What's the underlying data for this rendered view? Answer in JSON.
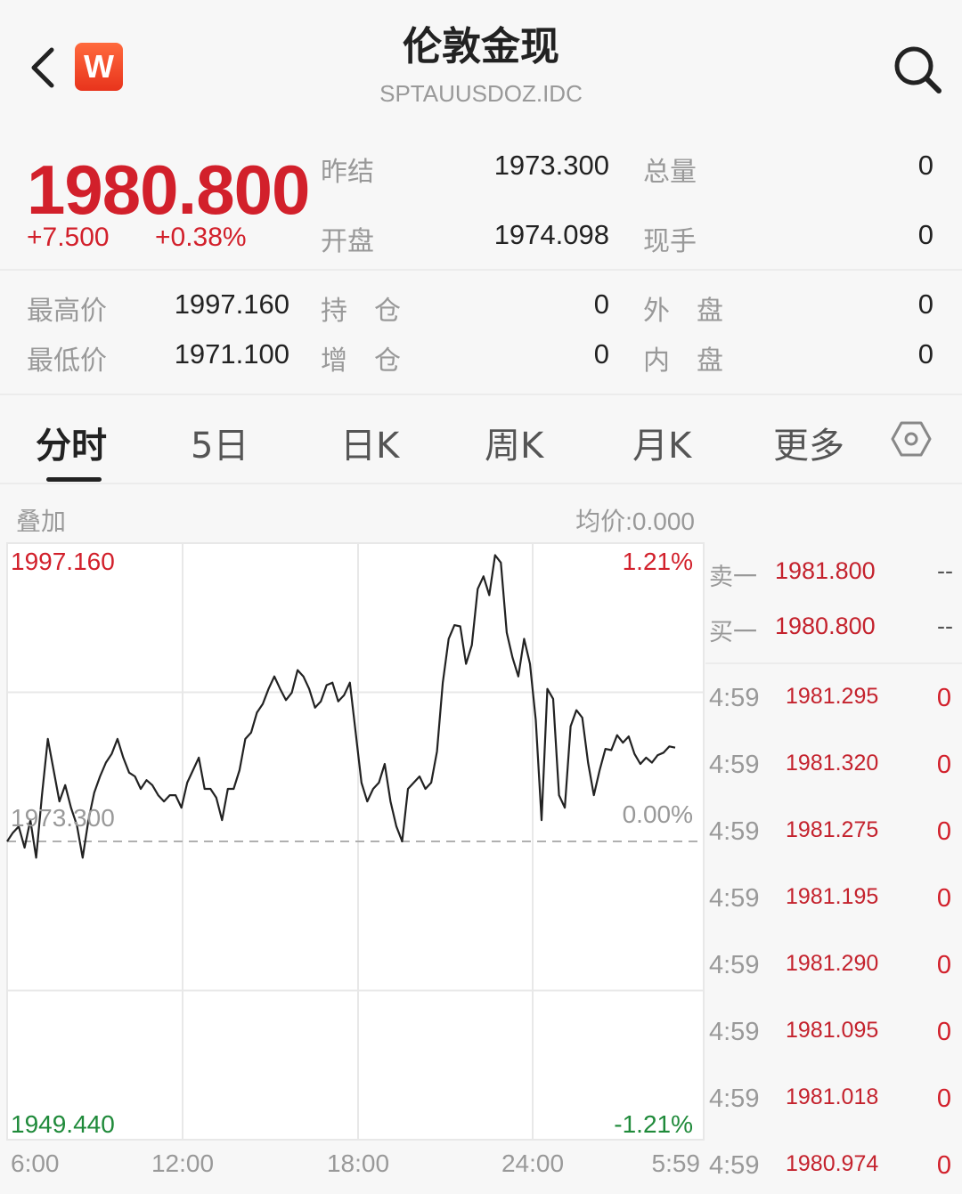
{
  "header": {
    "title": "伦敦金现",
    "code": "SPTAUUSDOZ.IDC",
    "logo_text": "W",
    "back_icon": "chevron-left-icon",
    "search_icon": "search-icon"
  },
  "quote": {
    "price": "1980.800",
    "change": "+7.500",
    "change_pct": "+0.38%",
    "prev_settle_label": "昨结",
    "prev_settle": "1973.300",
    "open_label": "开盘",
    "open": "1974.098",
    "total_vol_label": "总量",
    "total_vol": "0",
    "cur_hand_label": "现手",
    "cur_hand": "0",
    "high_label": "最高价",
    "high": "1997.160",
    "low_label": "最低价",
    "low": "1971.100",
    "position_label": "持　仓",
    "position": "0",
    "add_position_label": "增　仓",
    "add_position": "0",
    "outer_label": "外　盘",
    "outer": "0",
    "inner_label": "内　盘",
    "inner": "0"
  },
  "tabs": [
    {
      "label": "分时",
      "active": true
    },
    {
      "label": "5日",
      "active": false
    },
    {
      "label": "日K",
      "active": false
    },
    {
      "label": "周K",
      "active": false
    },
    {
      "label": "月K",
      "active": false
    },
    {
      "label": "更多",
      "active": false
    }
  ],
  "chart_toolbar": {
    "overlay_label": "叠加",
    "avg_price": "均价:0.000",
    "settings_icon": "hexagon-settings-icon"
  },
  "chart_data": {
    "type": "line",
    "y_max_label": "1997.160",
    "y_min_label": "1949.440",
    "y_ref_label": "1973.300",
    "pct_max": "1.21%",
    "pct_ref": "0.00%",
    "pct_min": "-1.21%",
    "ylim": [
      1949.44,
      1997.16
    ],
    "reference": 1973.3,
    "x_ticks": [
      "6:00",
      "12:00",
      "18:00",
      "24:00",
      "5:59"
    ],
    "series": [
      {
        "values": [
          1973.3,
          1974.0,
          1974.5,
          1972.8,
          1975.0,
          1972.0,
          1977.0,
          1981.5,
          1979.0,
          1976.5,
          1977.8,
          1976.0,
          1974.6,
          1972.0,
          1975.0,
          1977.2,
          1978.5,
          1979.6,
          1980.3,
          1981.5,
          1980.0,
          1978.8,
          1978.5,
          1977.5,
          1978.2,
          1977.8,
          1977.0,
          1976.5,
          1977.0,
          1977.0,
          1976.0,
          1978.0,
          1979.0,
          1980.0,
          1977.5,
          1977.5,
          1976.8,
          1975.0,
          1977.5,
          1977.5,
          1979.0,
          1981.5,
          1982.0,
          1983.6,
          1984.3,
          1985.5,
          1986.5,
          1985.5,
          1984.6,
          1985.2,
          1987.0,
          1986.5,
          1985.5,
          1984.0,
          1984.5,
          1985.8,
          1986.0,
          1984.5,
          1985.0,
          1986.0,
          1982.0,
          1978.0,
          1976.5,
          1977.5,
          1978.0,
          1979.5,
          1976.5,
          1974.5,
          1973.3,
          1977.5,
          1978.0,
          1978.5,
          1977.5,
          1978.0,
          1980.5,
          1986.0,
          1989.5,
          1990.6,
          1990.5,
          1987.5,
          1989.0,
          1993.5,
          1994.5,
          1993.0,
          1996.2,
          1995.6,
          1990.0,
          1988.0,
          1986.5,
          1989.5,
          1987.5,
          1983.0,
          1975.0,
          1985.5,
          1984.7,
          1977.0,
          1976.0,
          1982.5,
          1983.8,
          1983.2,
          1979.6,
          1977.0,
          1979.0,
          1980.7,
          1980.6,
          1981.8,
          1981.2,
          1981.7,
          1980.3,
          1979.5,
          1980.0,
          1979.6,
          1980.2,
          1980.4,
          1980.9,
          1980.8
        ]
      }
    ]
  },
  "order_book": [
    {
      "label": "卖一",
      "price": "1981.800",
      "volume": "--"
    },
    {
      "label": "买一",
      "price": "1980.800",
      "volume": "--"
    }
  ],
  "trades": [
    {
      "time": "4:59",
      "price": "1981.295",
      "volume": "0"
    },
    {
      "time": "4:59",
      "price": "1981.320",
      "volume": "0"
    },
    {
      "time": "4:59",
      "price": "1981.275",
      "volume": "0"
    },
    {
      "time": "4:59",
      "price": "1981.195",
      "volume": "0"
    },
    {
      "time": "4:59",
      "price": "1981.290",
      "volume": "0"
    },
    {
      "time": "4:59",
      "price": "1981.095",
      "volume": "0"
    },
    {
      "time": "4:59",
      "price": "1981.018",
      "volume": "0"
    },
    {
      "time": "4:59",
      "price": "1980.974",
      "volume": "0"
    }
  ],
  "colors": {
    "up": "#d2202b",
    "down": "#1f8a3a",
    "line": "#222222",
    "grid": "#e8e8e8",
    "ref_line": "#b0b0b0"
  }
}
